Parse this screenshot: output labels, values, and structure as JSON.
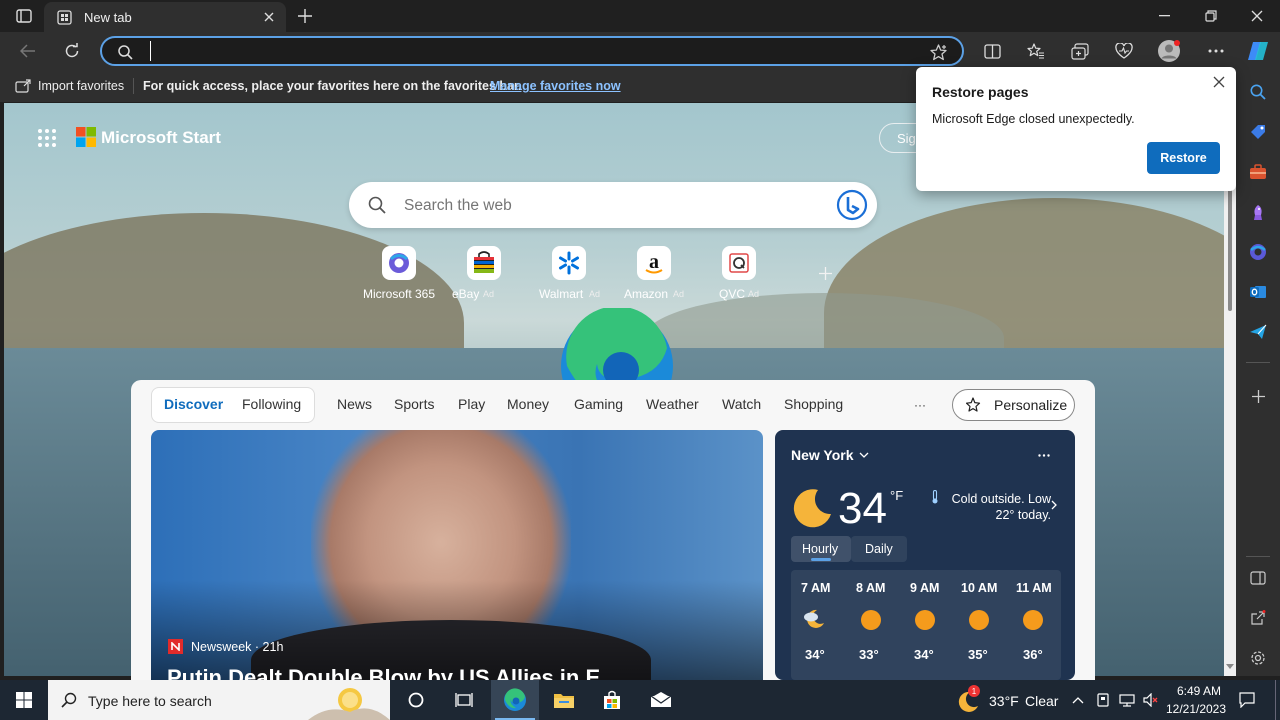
{
  "browser": {
    "tab_title": "New tab",
    "address_value": "",
    "favorites_bar": {
      "import_label": "Import favorites",
      "hint": "For quick access, place your favorites here on the favorites bar.",
      "manage_link": "Manage favorites now"
    }
  },
  "page": {
    "brand": "Microsoft Start",
    "sign_in_partial": "Sig",
    "search_placeholder": "Search the web",
    "quick_links": [
      {
        "label": "Microsoft 365",
        "ad": ""
      },
      {
        "label": "eBay",
        "ad": "Ad"
      },
      {
        "label": "Walmart",
        "ad": "Ad"
      },
      {
        "label": "Amazon",
        "ad": "Ad"
      },
      {
        "label": "QVC",
        "ad": "Ad"
      }
    ],
    "feed_tabs": [
      "Discover",
      "Following",
      "News",
      "Sports",
      "Play",
      "Money",
      "Gaming",
      "Weather",
      "Watch",
      "Shopping"
    ],
    "more": "···",
    "personalize": "Personalize",
    "article": {
      "source": "Newsweek · 21h",
      "headline_partial": "Putin Dealt Double Blow by US Allies in E"
    },
    "weather": {
      "city": "New York",
      "temp": "34",
      "unit": "°F",
      "summary": "Cold outside. Low 22° today.",
      "tabs": [
        "Hourly",
        "Daily"
      ],
      "hours": [
        {
          "time": "7 AM",
          "temp": "34°"
        },
        {
          "time": "8 AM",
          "temp": "33°"
        },
        {
          "time": "9 AM",
          "temp": "34°"
        },
        {
          "time": "10 AM",
          "temp": "35°"
        },
        {
          "time": "11 AM",
          "temp": "36°"
        }
      ]
    }
  },
  "popup": {
    "title": "Restore pages",
    "message": "Microsoft Edge closed unexpectedly.",
    "button": "Restore"
  },
  "taskbar": {
    "search_placeholder": "Type here to search",
    "weather_temp": "33°F",
    "weather_text": "Clear",
    "notification_count": "1",
    "time": "6:49 AM",
    "date": "12/21/2023"
  },
  "colors": {
    "accent": "#0f6cbd",
    "link": "#8cc2ff",
    "address_focus": "#5ca1e6",
    "weather_card": "#1f3350"
  }
}
